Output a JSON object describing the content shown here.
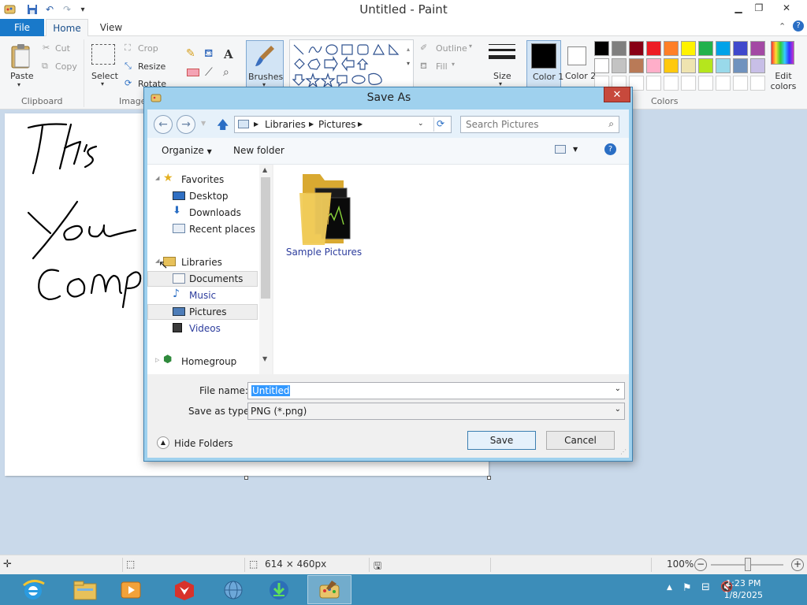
{
  "app": {
    "title": "Untitled - Paint"
  },
  "ribbon": {
    "tabs": {
      "file": "File",
      "home": "Home",
      "view": "View"
    },
    "clipboard": {
      "paste": "Paste",
      "cut": "Cut",
      "copy": "Copy",
      "label": "Clipboard"
    },
    "image": {
      "select": "Select",
      "crop": "Crop",
      "resize": "Resize",
      "rotate": "Rotate",
      "label": "Image"
    },
    "brushes": "Brushes",
    "shapes": {
      "outline": "Outline",
      "fill": "Fill"
    },
    "size": "Size",
    "color1": "Color 1",
    "color2": "Color 2",
    "colors_label": "Colors",
    "edit_colors": "Edit colors",
    "palette_row1": [
      "#000000",
      "#7f7f7f",
      "#880015",
      "#ed1c24",
      "#ff7f27",
      "#fff200",
      "#22b14c",
      "#00a2e8",
      "#3f48cc",
      "#a349a4"
    ],
    "palette_row2": [
      "#ffffff",
      "#c3c3c3",
      "#b97a57",
      "#ffaec9",
      "#ffc90e",
      "#efe4b0",
      "#b5e61d",
      "#99d9ea",
      "#7092be",
      "#c8bfe7"
    ]
  },
  "canvas": {
    "handwriting": [
      "Th's",
      "You",
      "Comp"
    ]
  },
  "status": {
    "dimensions": "614 × 460px",
    "zoom": "100%"
  },
  "dialog": {
    "title": "Save As",
    "breadcrumb": [
      "Libraries",
      "Pictures"
    ],
    "search_placeholder": "Search Pictures",
    "organize": "Organize",
    "new_folder": "New folder",
    "nav_tree": {
      "favorites": "Favorites",
      "desktop": "Desktop",
      "downloads": "Downloads",
      "recent_places": "Recent places",
      "libraries": "Libraries",
      "documents": "Documents",
      "music": "Music",
      "pictures": "Pictures",
      "videos": "Videos",
      "homegroup": "Homegroup"
    },
    "items": [
      {
        "name": "Sample Pictures"
      }
    ],
    "file_name_label": "File name:",
    "file_name_value": "Untitled",
    "save_type_label": "Save as type:",
    "save_type_value": "PNG (*.png)",
    "hide_folders": "Hide Folders",
    "save_button": "Save",
    "cancel_button": "Cancel"
  },
  "taskbar": {
    "time": "1:23 PM",
    "date": "1/8/2025"
  }
}
